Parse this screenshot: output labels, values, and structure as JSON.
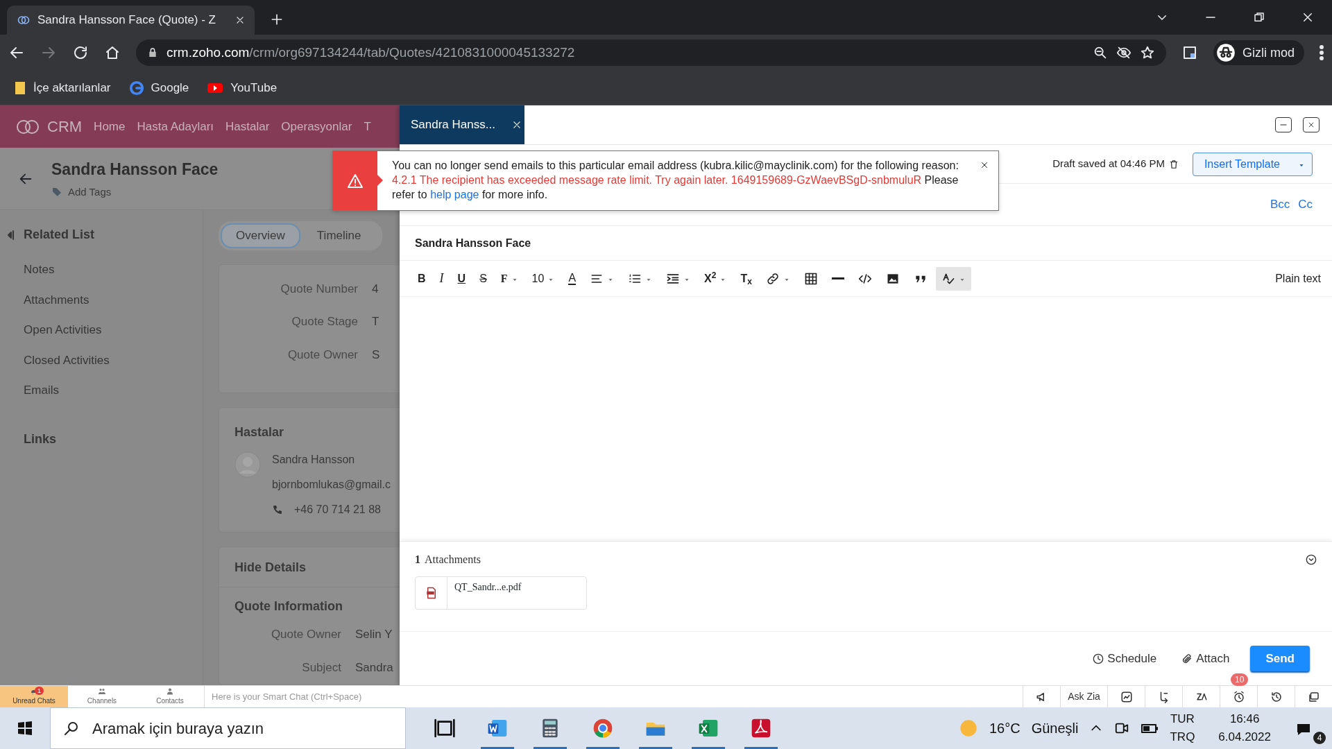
{
  "browser": {
    "tabs": [
      {
        "title": "Sandra Hansson Face (Quote) - Z",
        "selected": true
      }
    ],
    "url_host": "crm.zoho.com",
    "url_path": "/crm/org697134244/tab/Quotes/4210831000045133272",
    "profile": "Gizli mod",
    "bookmarks": [
      {
        "label": "İçe aktarılanlar",
        "kind": "folder"
      },
      {
        "label": "Google",
        "kind": "google"
      },
      {
        "label": "YouTube",
        "kind": "youtube"
      }
    ]
  },
  "crm": {
    "logo": "CRM",
    "nav": [
      "Home",
      "Hasta Adayları",
      "Hastalar",
      "Operasyonlar",
      "T"
    ],
    "record_title": "Sandra Hansson Face",
    "add_tags": "Add Tags",
    "related_heading": "Related List",
    "related_items": [
      "Notes",
      "Attachments",
      "Open Activities",
      "Closed Activities",
      "Emails"
    ],
    "links_heading": "Links",
    "view_tabs": [
      {
        "label": "Overview",
        "selected": true
      },
      {
        "label": "Timeline",
        "selected": false
      }
    ],
    "summary_fields": [
      {
        "label": "Quote Number",
        "value": "4"
      },
      {
        "label": "Quote Stage",
        "value": "T"
      },
      {
        "label": "Quote Owner",
        "value": "S"
      }
    ],
    "contact_card": {
      "heading": "Hastalar",
      "name": "Sandra Hansson",
      "email": "bjornbomlukas@gmail.c",
      "phone": "+46 70 714 21 88"
    },
    "details_heading": "Hide Details",
    "section_heading": "Quote Information",
    "info_fields": [
      {
        "label": "Quote Owner",
        "value": "Selin Y"
      },
      {
        "label": "Subject",
        "value": "Sandra"
      }
    ]
  },
  "compose": {
    "tab_title": "Sandra Hanss...",
    "draft_status": "Draft saved at 04:46 PM",
    "insert_template": "Insert Template",
    "bcc": "Bcc",
    "cc": "Cc",
    "subject": "Sandra Hansson Face",
    "toolbar": [
      {
        "kind": "bold",
        "label": "B",
        "dropdown": false,
        "active": false
      },
      {
        "kind": "italic",
        "label": "I",
        "dropdown": false,
        "active": false
      },
      {
        "kind": "underline",
        "label": "U",
        "dropdown": false,
        "active": false
      },
      {
        "kind": "strike",
        "label": "S",
        "dropdown": false,
        "active": false
      },
      {
        "kind": "font",
        "label": "F",
        "dropdown": true,
        "active": false
      },
      {
        "kind": "size",
        "label": "10",
        "dropdown": true,
        "active": false
      },
      {
        "kind": "color",
        "label": "A",
        "dropdown": false,
        "active": false
      },
      {
        "kind": "align",
        "dropdown": true,
        "active": false
      },
      {
        "kind": "list",
        "dropdown": true,
        "active": false
      },
      {
        "kind": "indent",
        "dropdown": true,
        "active": false
      },
      {
        "kind": "superscript",
        "label": "X$^{2}$",
        "dropdown": true,
        "active": false
      },
      {
        "kind": "clear",
        "label": "T$_{x}$",
        "dropdown": false,
        "active": false
      },
      {
        "kind": "link",
        "dropdown": true,
        "active": false
      },
      {
        "kind": "table",
        "dropdown": false,
        "active": false
      },
      {
        "kind": "rule",
        "dropdown": false,
        "active": false
      },
      {
        "kind": "code",
        "dropdown": false,
        "active": false
      },
      {
        "kind": "image",
        "dropdown": false,
        "active": false
      },
      {
        "kind": "quote",
        "dropdown": false,
        "active": false
      },
      {
        "kind": "spellcheck",
        "dropdown": true,
        "active": true
      }
    ],
    "plain_text": "Plain text",
    "attachments_count": "1",
    "attachments_label": "Attachments",
    "files": [
      {
        "name": "QT_Sandr...e.pdf"
      }
    ],
    "schedule": "Schedule",
    "attach": "Attach",
    "send": "Send"
  },
  "error": {
    "text_before": "You can no longer send emails to this particular email address (kubra.kilic@mayclinik.com) for the following reason: ",
    "detail": "4.2.1 The recipient has exceeded message rate limit. Try again later. 1649159689-GzWaevBSgD-snbmuluR",
    "text_middle": " Please refer to ",
    "link": "help page",
    "text_after": " for more info."
  },
  "zoho_bar": {
    "tabs": [
      {
        "label": "Unread Chats",
        "badge": "1",
        "selected": true
      },
      {
        "label": "Channels",
        "selected": false
      },
      {
        "label": "Contacts",
        "selected": false
      }
    ],
    "placeholder": "Here is your Smart Chat (Ctrl+Space)",
    "tools": [
      {
        "kind": "announce"
      },
      {
        "kind": "text",
        "label": "Ask Zia"
      },
      {
        "kind": "chart"
      },
      {
        "kind": "sync"
      },
      {
        "kind": "zia"
      },
      {
        "kind": "alarm",
        "badge": "10"
      },
      {
        "kind": "history"
      },
      {
        "kind": "chat"
      }
    ]
  },
  "taskbar": {
    "search_placeholder": "Aramak için buraya yazın",
    "apps": [
      {
        "kind": "taskview",
        "running": false
      },
      {
        "kind": "word",
        "running": true
      },
      {
        "kind": "calculator",
        "running": true
      },
      {
        "kind": "chrome",
        "running": true
      },
      {
        "kind": "explorer",
        "running": true
      },
      {
        "kind": "excel",
        "running": true
      },
      {
        "kind": "acrobat",
        "running": true
      }
    ],
    "temperature": "16°C",
    "weather": "Güneşli",
    "lang_top": "TUR",
    "lang_bottom": "TRQ",
    "time": "16:46",
    "date": "6.04.2022",
    "notifications": "4"
  }
}
